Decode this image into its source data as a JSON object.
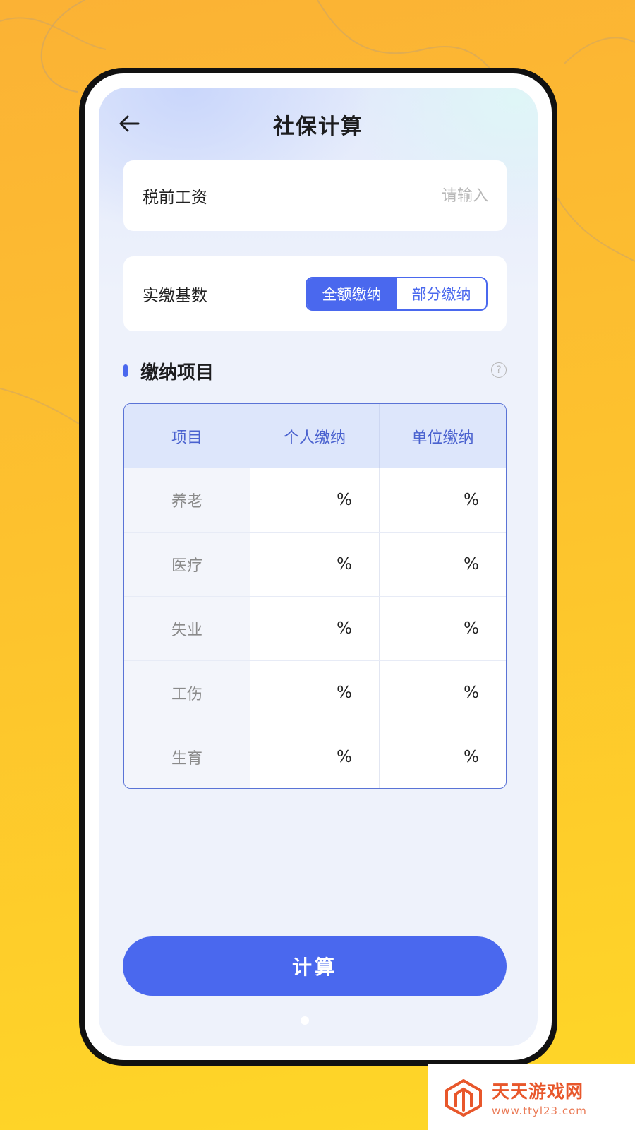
{
  "page": {
    "title": "社保计算"
  },
  "salary": {
    "label": "税前工资",
    "value": "",
    "placeholder": "请输入"
  },
  "base": {
    "label": "实缴基数",
    "options": [
      {
        "label": "全额缴纳",
        "selected": true
      },
      {
        "label": "部分缴纳",
        "selected": false
      }
    ]
  },
  "section": {
    "title": "缴纳项目",
    "help_icon": "question-circle-icon"
  },
  "table": {
    "headers": [
      "项目",
      "个人缴纳",
      "单位缴纳"
    ],
    "rows": [
      {
        "name": "养老",
        "personal": "",
        "company": "",
        "unit": "%"
      },
      {
        "name": "医疗",
        "personal": "",
        "company": "",
        "unit": "%"
      },
      {
        "name": "失业",
        "personal": "",
        "company": "",
        "unit": "%"
      },
      {
        "name": "工伤",
        "personal": "",
        "company": "",
        "unit": "%"
      },
      {
        "name": "生育",
        "personal": "",
        "company": "",
        "unit": "%"
      }
    ]
  },
  "actions": {
    "calculate_label": "计算"
  },
  "watermark": {
    "title": "天天游戏网",
    "url": "www.ttyl23.com"
  },
  "colors": {
    "accent": "#4a68ee",
    "background": "#fdc22e",
    "watermark": "#e8572b"
  }
}
